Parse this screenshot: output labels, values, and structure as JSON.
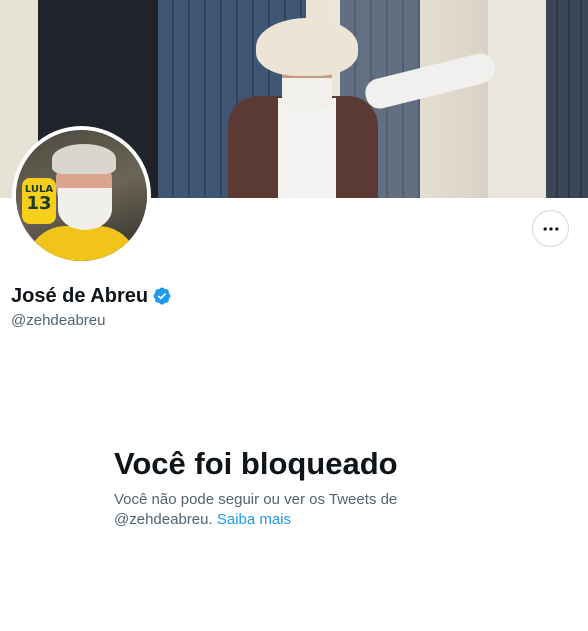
{
  "profile": {
    "display_name": "José de Abreu",
    "handle": "@zehdeabreu",
    "verified": true,
    "avatar_jersey_text": "LULA",
    "avatar_jersey_number": "13"
  },
  "more_button": {
    "icon": "more-horizontal-icon"
  },
  "blocked_notice": {
    "title": "Você foi bloqueado",
    "message_line1": "Você não pode seguir ou ver os Tweets de",
    "message_handle": "@zehdeabreu.",
    "learn_more": "Saiba mais"
  },
  "colors": {
    "accent": "#1d9bf0",
    "text_primary": "#0f1419",
    "text_secondary": "#536471",
    "border": "#cfd9de"
  }
}
